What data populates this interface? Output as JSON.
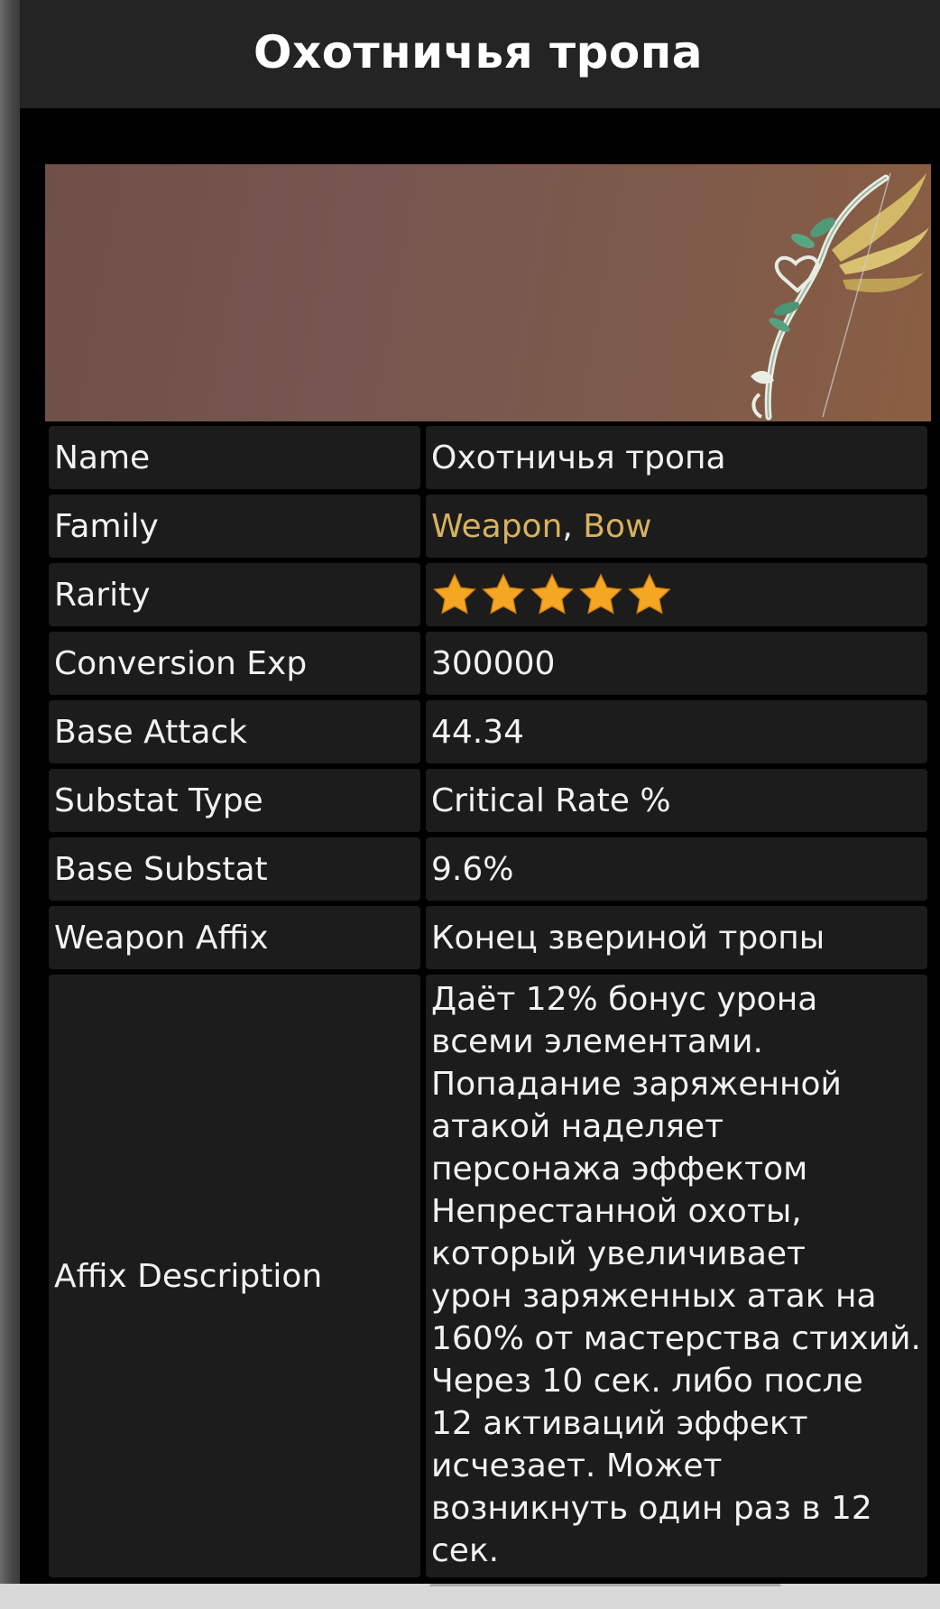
{
  "header": {
    "title": "Охотничья тропа"
  },
  "banner": {
    "image_icon": "bow-icon"
  },
  "rows": [
    {
      "label": "Name",
      "value": "Охотничья тропа"
    },
    {
      "label": "Family",
      "value_links": [
        "Weapon",
        "Bow"
      ],
      "separator": ", "
    },
    {
      "label": "Rarity",
      "stars": 5,
      "star_icon": "star-icon"
    },
    {
      "label": "Conversion Exp",
      "value": "300000"
    },
    {
      "label": "Base Attack",
      "value": "44.34"
    },
    {
      "label": "Substat Type",
      "value": "Critical Rate %"
    },
    {
      "label": "Base Substat",
      "value": "9.6%"
    },
    {
      "label": "Weapon Affix",
      "value": "Конец звериной тропы"
    },
    {
      "label": "Affix Description",
      "value_lines": [
        "Даёт 12% бонус урона",
        "всеми элементами.",
        "Попадание заряженной",
        "атакой наделяет",
        "персонажа эффектом",
        "Непрестанной охоты,",
        "который увеличивает",
        "урон заряженных атак на",
        "160% от мастерства стихий.",
        "Через 10 сек. либо после",
        "12 активаций эффект",
        "исчезает. Может",
        "возникнуть один раз в 12",
        "сек."
      ]
    }
  ],
  "colors": {
    "link": "#d8b15e",
    "star": "#f5a623",
    "cell_bg": "#1c1c1c",
    "header_bg": "#242424"
  }
}
